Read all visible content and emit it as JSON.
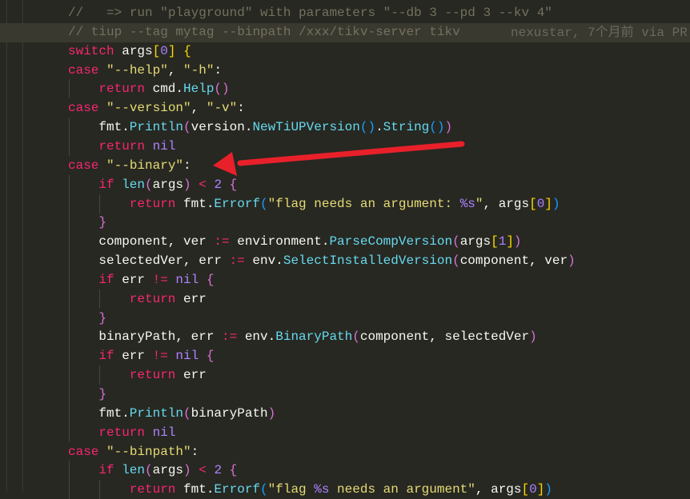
{
  "editor": {
    "blame": "nexustar, 7个月前 via PR",
    "current_line_index": 1,
    "lines": [
      {
        "indent": 0,
        "tokens": [
          [
            "c",
            "//   => run \"playground\" with parameters \"--db 3 --pd 3 --kv 4\""
          ]
        ]
      },
      {
        "indent": 0,
        "tokens": [
          [
            "c",
            "// tiup --tag mytag --binpath /xxx/tikv-server tikv"
          ]
        ]
      },
      {
        "indent": 0,
        "tokens": [
          [
            "k",
            "switch"
          ],
          [
            "p",
            " args"
          ],
          [
            "b1",
            "["
          ],
          [
            "n",
            "0"
          ],
          [
            "b1",
            "]"
          ],
          [
            "p",
            " "
          ],
          [
            "b1",
            "{"
          ]
        ]
      },
      {
        "indent": 0,
        "tokens": [
          [
            "k",
            "case"
          ],
          [
            "p",
            " "
          ],
          [
            "s",
            "\"--help\""
          ],
          [
            "p",
            ", "
          ],
          [
            "s",
            "\"-h\""
          ],
          [
            "p",
            ":"
          ]
        ]
      },
      {
        "indent": 1,
        "tokens": [
          [
            "k",
            "return"
          ],
          [
            "p",
            " cmd."
          ],
          [
            "f",
            "Help"
          ],
          [
            "b2",
            "()"
          ]
        ]
      },
      {
        "indent": 0,
        "tokens": [
          [
            "k",
            "case"
          ],
          [
            "p",
            " "
          ],
          [
            "s",
            "\"--version\""
          ],
          [
            "p",
            ", "
          ],
          [
            "s",
            "\"-v\""
          ],
          [
            "p",
            ":"
          ]
        ]
      },
      {
        "indent": 1,
        "tokens": [
          [
            "p",
            "fmt."
          ],
          [
            "f",
            "Println"
          ],
          [
            "b2",
            "("
          ],
          [
            "p",
            "version."
          ],
          [
            "f",
            "NewTiUPVersion"
          ],
          [
            "b3",
            "()"
          ],
          [
            "p",
            "."
          ],
          [
            "f",
            "String"
          ],
          [
            "b3",
            "()"
          ],
          [
            "b2",
            ")"
          ]
        ]
      },
      {
        "indent": 1,
        "tokens": [
          [
            "k",
            "return"
          ],
          [
            "p",
            " "
          ],
          [
            "n",
            "nil"
          ]
        ]
      },
      {
        "indent": 0,
        "tokens": [
          [
            "k",
            "case"
          ],
          [
            "p",
            " "
          ],
          [
            "s",
            "\"--binary\""
          ],
          [
            "p",
            ":"
          ]
        ]
      },
      {
        "indent": 1,
        "tokens": [
          [
            "k",
            "if"
          ],
          [
            "p",
            " "
          ],
          [
            "f",
            "len"
          ],
          [
            "b2",
            "("
          ],
          [
            "p",
            "args"
          ],
          [
            "b2",
            ")"
          ],
          [
            "k",
            " < "
          ],
          [
            "n",
            "2"
          ],
          [
            "p",
            " "
          ],
          [
            "b2",
            "{"
          ]
        ]
      },
      {
        "indent": 2,
        "tokens": [
          [
            "k",
            "return"
          ],
          [
            "p",
            " fmt."
          ],
          [
            "f",
            "Errorf"
          ],
          [
            "b3",
            "("
          ],
          [
            "s",
            "\"flag needs an argument: "
          ],
          [
            "n",
            "%s"
          ],
          [
            "s",
            "\""
          ],
          [
            "p",
            ", args"
          ],
          [
            "b1",
            "["
          ],
          [
            "n",
            "0"
          ],
          [
            "b1",
            "]"
          ],
          [
            "b3",
            ")"
          ]
        ]
      },
      {
        "indent": 1,
        "tokens": [
          [
            "b2",
            "}"
          ]
        ]
      },
      {
        "indent": 1,
        "tokens": [
          [
            "p",
            "component, ver "
          ],
          [
            "k",
            ":="
          ],
          [
            "p",
            " environment."
          ],
          [
            "f",
            "ParseCompVersion"
          ],
          [
            "b2",
            "("
          ],
          [
            "p",
            "args"
          ],
          [
            "b1",
            "["
          ],
          [
            "n",
            "1"
          ],
          [
            "b1",
            "]"
          ],
          [
            "b2",
            ")"
          ]
        ]
      },
      {
        "indent": 1,
        "tokens": [
          [
            "p",
            "selectedVer, err "
          ],
          [
            "k",
            ":="
          ],
          [
            "p",
            " env."
          ],
          [
            "f",
            "SelectInstalledVersion"
          ],
          [
            "b2",
            "("
          ],
          [
            "p",
            "component, ver"
          ],
          [
            "b2",
            ")"
          ]
        ]
      },
      {
        "indent": 1,
        "tokens": [
          [
            "k",
            "if"
          ],
          [
            "p",
            " err "
          ],
          [
            "k",
            "!="
          ],
          [
            "p",
            " "
          ],
          [
            "n",
            "nil"
          ],
          [
            "p",
            " "
          ],
          [
            "b2",
            "{"
          ]
        ]
      },
      {
        "indent": 2,
        "tokens": [
          [
            "k",
            "return"
          ],
          [
            "p",
            " err"
          ]
        ]
      },
      {
        "indent": 1,
        "tokens": [
          [
            "b2",
            "}"
          ]
        ]
      },
      {
        "indent": 1,
        "tokens": [
          [
            "p",
            "binaryPath, err "
          ],
          [
            "k",
            ":="
          ],
          [
            "p",
            " env."
          ],
          [
            "f",
            "BinaryPath"
          ],
          [
            "b2",
            "("
          ],
          [
            "p",
            "component, selectedVer"
          ],
          [
            "b2",
            ")"
          ]
        ]
      },
      {
        "indent": 1,
        "tokens": [
          [
            "k",
            "if"
          ],
          [
            "p",
            " err "
          ],
          [
            "k",
            "!="
          ],
          [
            "p",
            " "
          ],
          [
            "n",
            "nil"
          ],
          [
            "p",
            " "
          ],
          [
            "b2",
            "{"
          ]
        ]
      },
      {
        "indent": 2,
        "tokens": [
          [
            "k",
            "return"
          ],
          [
            "p",
            " err"
          ]
        ]
      },
      {
        "indent": 1,
        "tokens": [
          [
            "b2",
            "}"
          ]
        ]
      },
      {
        "indent": 1,
        "tokens": [
          [
            "p",
            "fmt."
          ],
          [
            "f",
            "Println"
          ],
          [
            "b2",
            "("
          ],
          [
            "p",
            "binaryPath"
          ],
          [
            "b2",
            ")"
          ]
        ]
      },
      {
        "indent": 1,
        "tokens": [
          [
            "k",
            "return"
          ],
          [
            "p",
            " "
          ],
          [
            "n",
            "nil"
          ]
        ]
      },
      {
        "indent": 0,
        "tokens": [
          [
            "k",
            "case"
          ],
          [
            "p",
            " "
          ],
          [
            "s",
            "\"--binpath\""
          ],
          [
            "p",
            ":"
          ]
        ]
      },
      {
        "indent": 1,
        "tokens": [
          [
            "k",
            "if"
          ],
          [
            "p",
            " "
          ],
          [
            "f",
            "len"
          ],
          [
            "b2",
            "("
          ],
          [
            "p",
            "args"
          ],
          [
            "b2",
            ")"
          ],
          [
            "k",
            " < "
          ],
          [
            "n",
            "2"
          ],
          [
            "p",
            " "
          ],
          [
            "b2",
            "{"
          ]
        ]
      },
      {
        "indent": 2,
        "tokens": [
          [
            "k",
            "return"
          ],
          [
            "p",
            " fmt."
          ],
          [
            "f",
            "Errorf"
          ],
          [
            "b3",
            "("
          ],
          [
            "s",
            "\"flag "
          ],
          [
            "n",
            "%s"
          ],
          [
            "s",
            " needs an argument\""
          ],
          [
            "p",
            ", args"
          ],
          [
            "b1",
            "["
          ],
          [
            "n",
            "0"
          ],
          [
            "b1",
            "]"
          ],
          [
            "b3",
            ")"
          ]
        ]
      }
    ]
  },
  "annotation": {
    "arrow_color": "#e8202a"
  }
}
